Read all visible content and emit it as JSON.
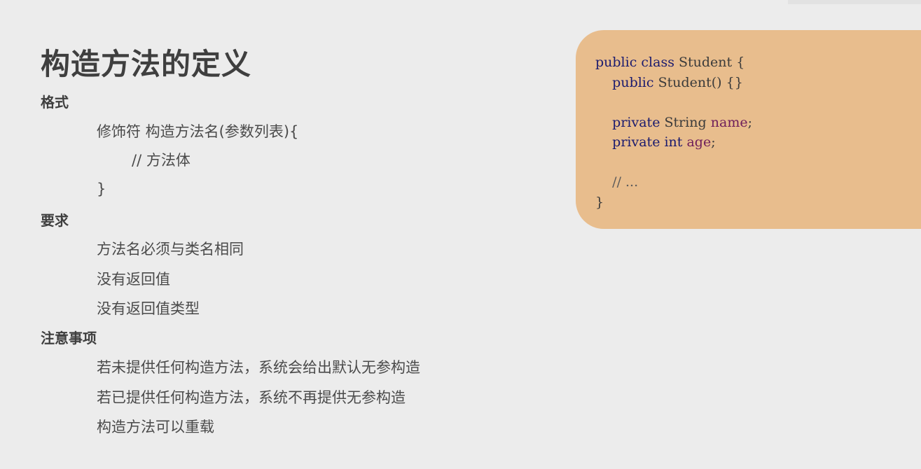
{
  "slide": {
    "title": "构造方法的定义",
    "sections": [
      {
        "heading": "格式",
        "lines": [
          "修饰符 构造方法名(参数列表){",
          "// 方法体",
          "}"
        ]
      },
      {
        "heading": "要求",
        "lines": [
          "方法名必须与类名相同",
          "没有返回值",
          "没有返回值类型"
        ]
      },
      {
        "heading": "注意事项",
        "lines": [
          "若未提供任何构造方法，系统会给出默认无参构造",
          "若已提供任何构造方法，系统不再提供无参构造",
          "构造方法可以重载"
        ]
      }
    ]
  },
  "code": {
    "line1": {
      "kw1": "public",
      "kw2": "class",
      "name": "Student",
      "brace": "{"
    },
    "line2": {
      "kw1": "public",
      "rest": "Student()",
      "braces": "{}"
    },
    "line4": {
      "kw1": "private",
      "type": "String",
      "var": "name",
      "end": ";"
    },
    "line5": {
      "kw1": "private",
      "type": "int",
      "var": "age",
      "end": ";"
    },
    "line7": {
      "comment": "// ..."
    },
    "line8": {
      "brace": "}"
    }
  },
  "colors": {
    "background": "#ececec",
    "code_box": "#e8bd8d",
    "keyword": "#1a1a6e",
    "variable": "#6e1e5a"
  }
}
